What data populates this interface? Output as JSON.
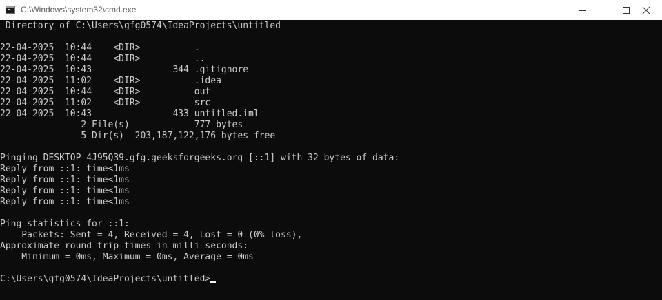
{
  "window": {
    "title": "C:\\Windows\\system32\\cmd.exe",
    "controls": {
      "minimize_icon": "minimize-icon",
      "maximize_icon": "maximize-icon",
      "close_icon": "close-icon"
    }
  },
  "console": {
    "directory_header": " Directory of C:\\Users\\gfg0574\\IdeaProjects\\untitled",
    "listing": [
      "22-04-2025  10:44    <DIR>          .",
      "22-04-2025  10:44    <DIR>          ..",
      "22-04-2025  10:43               344 .gitignore",
      "22-04-2025  11:02    <DIR>          .idea",
      "22-04-2025  10:44    <DIR>          out",
      "22-04-2025  11:02    <DIR>          src",
      "22-04-2025  10:43               433 untitled.iml"
    ],
    "summary": [
      "               2 File(s)            777 bytes",
      "               5 Dir(s)  203,187,122,176 bytes free"
    ],
    "ping_header": "Pinging DESKTOP-4J95Q39.gfg.geeksforgeeks.org [::1] with 32 bytes of data:",
    "replies": [
      "Reply from ::1: time<1ms",
      "Reply from ::1: time<1ms",
      "Reply from ::1: time<1ms",
      "Reply from ::1: time<1ms"
    ],
    "stats": [
      "Ping statistics for ::1:",
      "    Packets: Sent = 4, Received = 4, Lost = 0 (0% loss),",
      "Approximate round trip times in milli-seconds:",
      "    Minimum = 0ms, Maximum = 0ms, Average = 0ms"
    ],
    "prompt": "C:\\Users\\gfg0574\\IdeaProjects\\untitled>"
  },
  "colors": {
    "console_background": "#0c0c0c",
    "console_text": "#cccccc",
    "titlebar_background": "#ffffff"
  }
}
